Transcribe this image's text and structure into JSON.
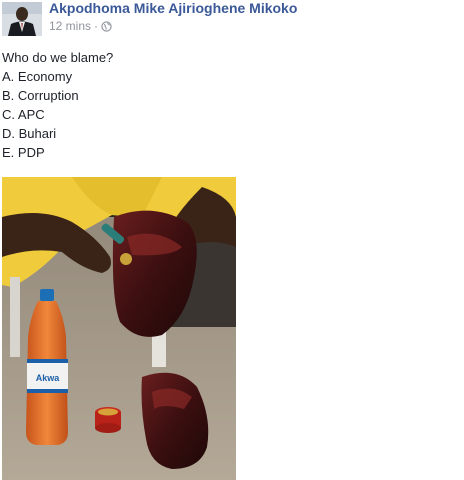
{
  "post": {
    "author_name": "Akpodhoma Mike Ajirioghene Mikoko",
    "timestamp": "12 mins",
    "separator": "·",
    "audience_icon": "globe-icon",
    "body": {
      "question": "Who do we blame?",
      "options": [
        "A. Economy",
        "B. Corruption",
        "C. APC",
        "D. Buhari",
        "E. PDP"
      ]
    },
    "photo": {
      "bottle_label": "Akwa"
    }
  },
  "colors": {
    "author_link": "#3b5998",
    "meta_text": "#90949c",
    "body_text": "#1d2129"
  }
}
